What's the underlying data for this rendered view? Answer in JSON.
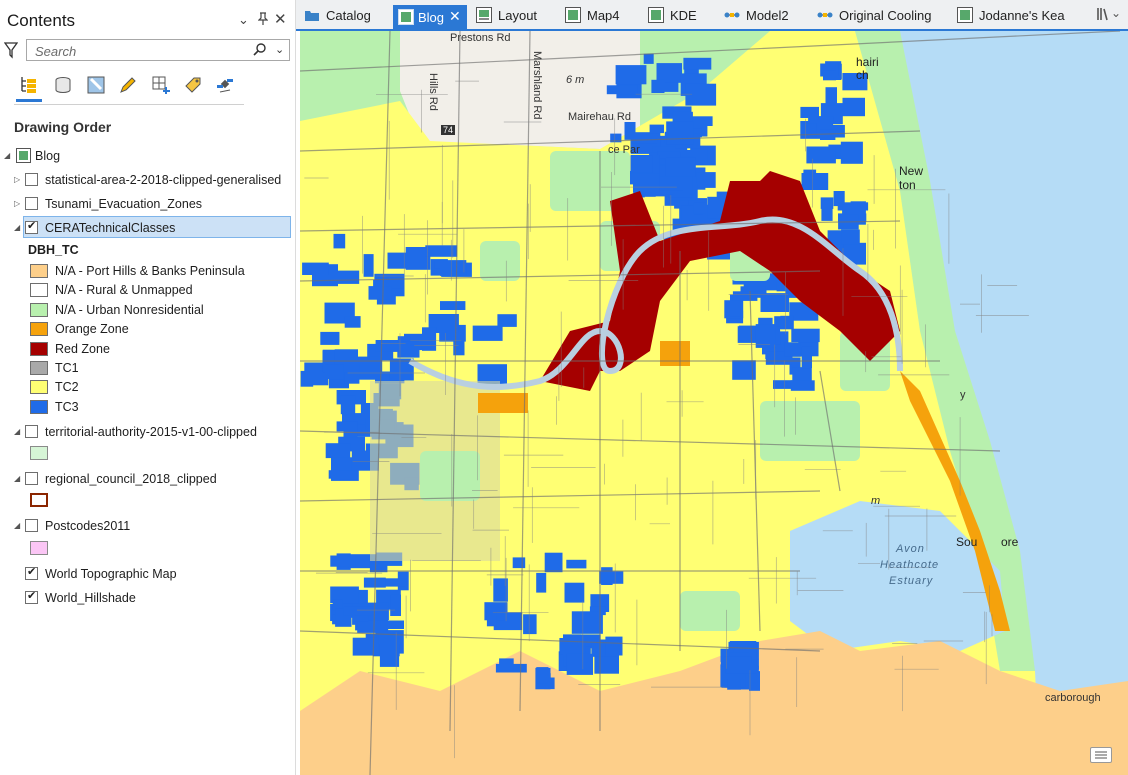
{
  "contents": {
    "title": "Contents",
    "search_placeholder": "Search",
    "drawing_order": "Drawing Order",
    "map_name": "Blog",
    "layers": [
      {
        "label": "statistical-area-2-2018-clipped-generalised",
        "checked": false
      },
      {
        "label": "Tsunami_Evacuation_Zones",
        "checked": false
      },
      {
        "label": "CERATechnicalClasses",
        "checked": true
      }
    ],
    "legend_field": "DBH_TC",
    "legend": [
      {
        "label": "N/A - Port Hills & Banks Peninsula",
        "color": "#fdcf8a"
      },
      {
        "label": "N/A - Rural & Unmapped",
        "color": "#ffffff"
      },
      {
        "label": "N/A - Urban Nonresidential",
        "color": "#b8f0ae"
      },
      {
        "label": "Orange Zone",
        "color": "#f5a20c"
      },
      {
        "label": "Red Zone",
        "color": "#a50000"
      },
      {
        "label": "TC1",
        "color": "#a9a9a9"
      },
      {
        "label": "TC2",
        "color": "#ffff73"
      },
      {
        "label": "TC3",
        "color": "#1f6be8"
      }
    ],
    "other_layers": [
      {
        "label": "territorial-authority-2015-v1-00-clipped",
        "swatch_fill": "#d6f5d6",
        "swatch_border": "#8a8a8a",
        "checked": false
      },
      {
        "label": "regional_council_2018_clipped",
        "swatch_fill": "#ffffff",
        "swatch_border": "#8b2500",
        "checked": false
      },
      {
        "label": "Postcodes2011",
        "swatch_fill": "#fbc6f5",
        "swatch_border": "#8a8a8a",
        "checked": false
      }
    ],
    "basemaps": [
      {
        "label": "World Topographic Map",
        "checked": true
      },
      {
        "label": "World_Hillshade",
        "checked": true
      }
    ]
  },
  "tabs": [
    {
      "label": "Catalog",
      "icon": "catalog-icon",
      "active": false
    },
    {
      "label": "Blog",
      "icon": "map-icon",
      "active": true
    },
    {
      "label": "Layout",
      "icon": "layout-icon",
      "active": false
    },
    {
      "label": "Map4",
      "icon": "map-icon",
      "active": false
    },
    {
      "label": "KDE",
      "icon": "map-icon",
      "active": false
    },
    {
      "label": "Model2",
      "icon": "model-icon",
      "active": false
    },
    {
      "label": "Original Cooling",
      "icon": "model-icon",
      "active": false
    },
    {
      "label": "Jodanne's Kea",
      "icon": "map-icon",
      "active": false
    }
  ],
  "map_labels": {
    "prestons": "Prestons Rd",
    "marshland": "Marshland Rd",
    "hills": "Hills Rd",
    "mairehau": "Mairehau Rd",
    "elev_6m": "6 m",
    "road_74": "74",
    "parklands_part": "ce Par",
    "shirley_part": "hairi ch",
    "new": "New",
    "ton": "ton",
    "south": "Sou",
    "shore": "ore",
    "avon": "Avon",
    "heathcote": "Heathcote",
    "estuary": "Estuary",
    "scarborough": "carborough",
    "elev_m": "m",
    "bay_y": "y"
  },
  "colors": {
    "accent": "#2b78d4",
    "sea": "#b5dcf6",
    "tc2": "#ffff73",
    "tc3": "#1f6be8",
    "red_zone": "#a50000",
    "orange_zone": "#f5a20c",
    "urban_nonres": "#b8f0ae",
    "port_hills": "#fdcf8a"
  }
}
